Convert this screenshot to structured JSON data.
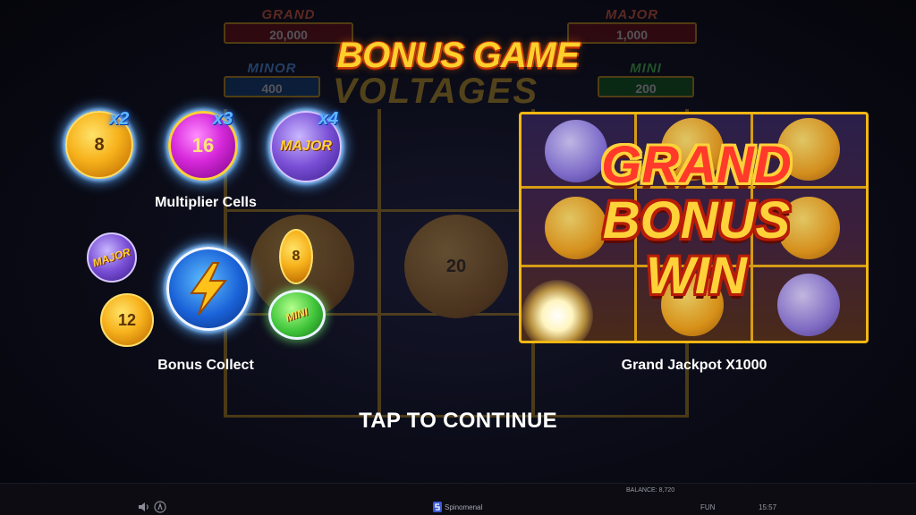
{
  "jackpots": {
    "grand": {
      "label": "GRAND",
      "value": "20,000"
    },
    "major": {
      "label": "MAJOR",
      "value": "1,000"
    },
    "minor": {
      "label": "MINOR",
      "value": "400"
    },
    "mini": {
      "label": "MINI",
      "value": "200"
    }
  },
  "background": {
    "logo_text": "VOLTAGES",
    "coin_value": "20"
  },
  "title": "BONUS GAME",
  "multiplier_cells": {
    "caption": "Multiplier Cells",
    "items": [
      {
        "coin": "8",
        "multiplier": "x2"
      },
      {
        "coin": "16",
        "multiplier": "x3"
      },
      {
        "coin": "MAJOR",
        "multiplier": "x4"
      }
    ]
  },
  "bonus_collect": {
    "caption": "Bonus Collect",
    "coins": {
      "major": "MAJOR",
      "twelve": "12",
      "eight": "8",
      "mini": "MINI"
    }
  },
  "grand_win": {
    "line1": "GRAND",
    "line2": "BONUS",
    "line3": "WIN",
    "caption": "Grand Jackpot X1000"
  },
  "tap_to_continue": "TAP TO CONTINUE",
  "bottom_bar": {
    "brand": "Spinomenal",
    "balance_label": "BALANCE:",
    "balance_value": "8,720",
    "mode": "FUN",
    "time": "15:57"
  },
  "colors": {
    "title_gold": "#ffcf2c",
    "frame_gold": "#f3b614",
    "multiplier_blue": "#5fb8ff"
  }
}
